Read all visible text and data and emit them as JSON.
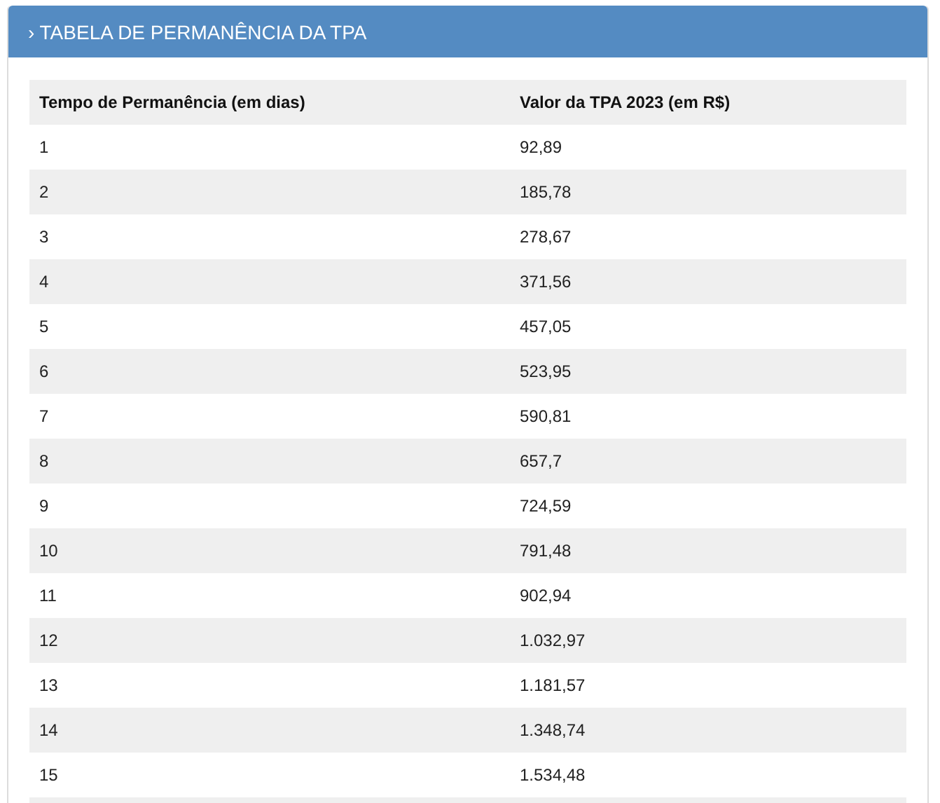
{
  "panel": {
    "title": "› TABELA DE PERMANÊNCIA DA TPA"
  },
  "table": {
    "columns": [
      "Tempo de Permanência (em dias)",
      "Valor da TPA 2023 (em R$)"
    ],
    "rows": [
      [
        "1",
        "92,89"
      ],
      [
        "2",
        "185,78"
      ],
      [
        "3",
        "278,67"
      ],
      [
        "4",
        "371,56"
      ],
      [
        "5",
        "457,05"
      ],
      [
        "6",
        "523,95"
      ],
      [
        "7",
        "590,81"
      ],
      [
        "8",
        "657,7"
      ],
      [
        "9",
        "724,59"
      ],
      [
        "10",
        "791,48"
      ],
      [
        "11",
        "902,94"
      ],
      [
        "12",
        "1.032,97"
      ],
      [
        "13",
        "1.181,57"
      ],
      [
        "14",
        "1.348,74"
      ],
      [
        "15",
        "1.534,48"
      ]
    ]
  }
}
